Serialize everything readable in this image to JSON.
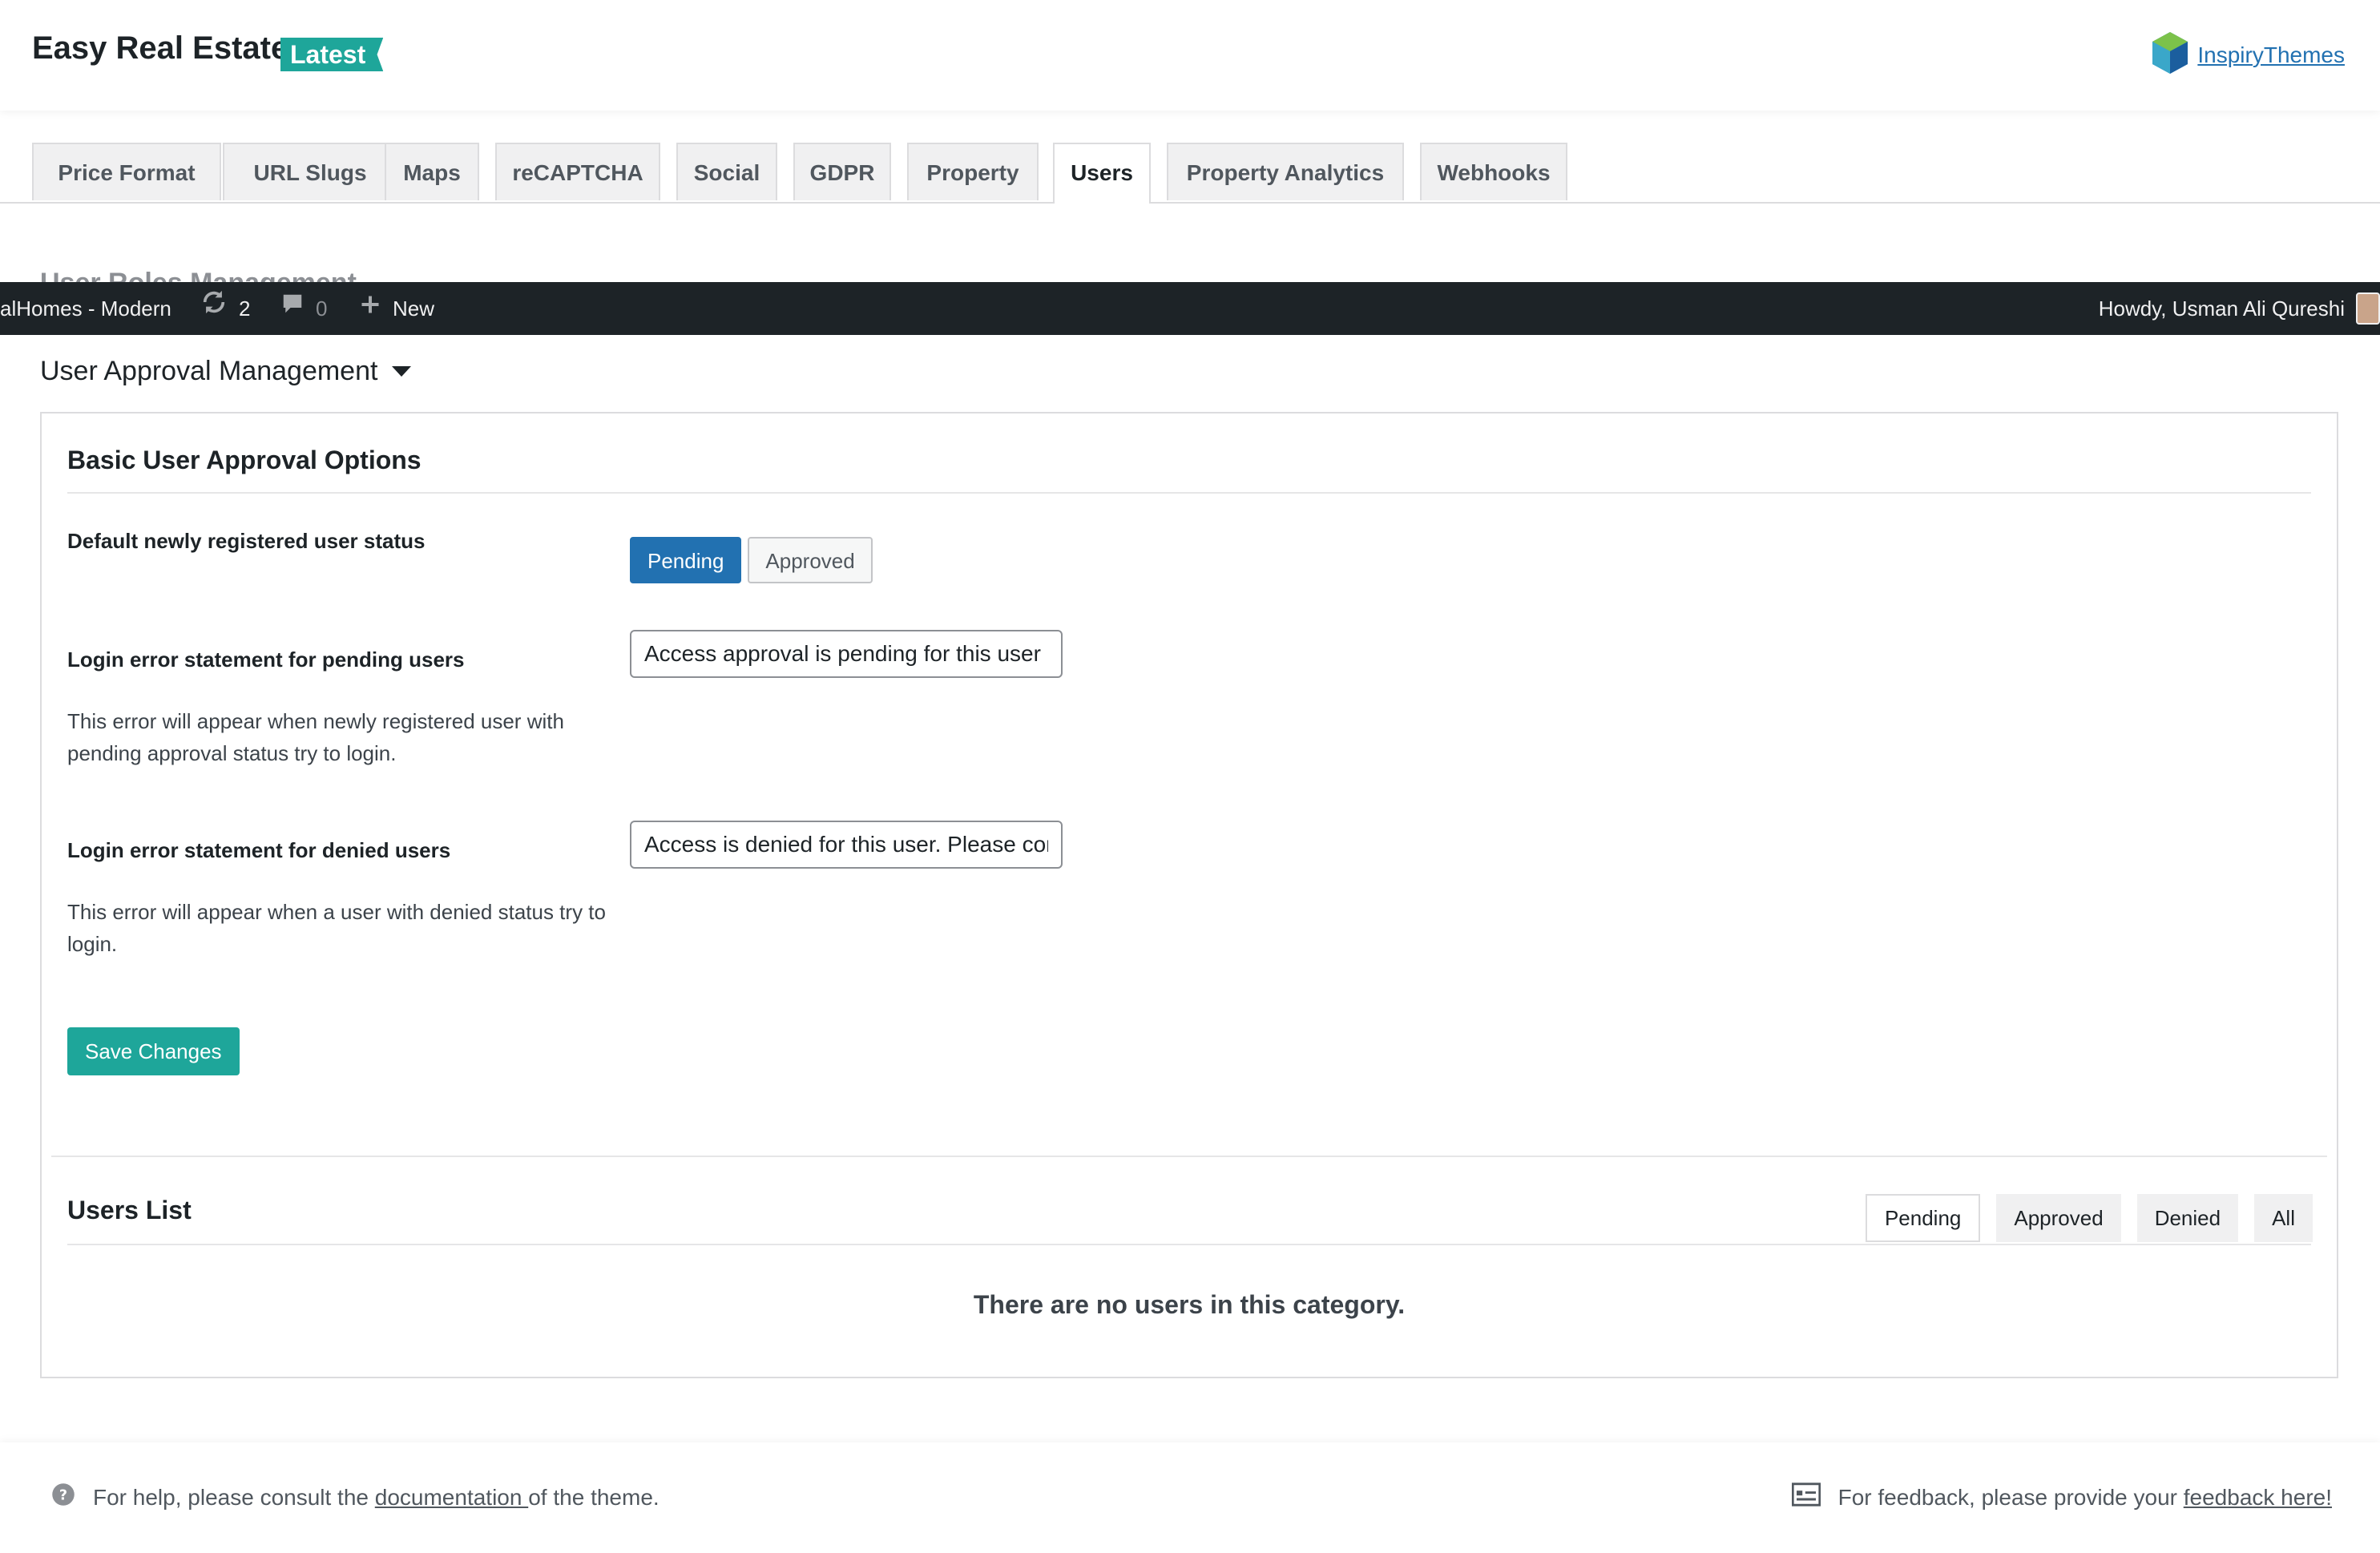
{
  "header": {
    "brand": "Easy Real Estate",
    "badge": "Latest",
    "vendor_link": "InspiryThemes"
  },
  "tabs": [
    {
      "label": "Price Format"
    },
    {
      "label": "URL Slugs"
    },
    {
      "label": "Maps"
    },
    {
      "label": "reCAPTCHA"
    },
    {
      "label": "Social"
    },
    {
      "label": "GDPR"
    },
    {
      "label": "Property"
    },
    {
      "label": "Users",
      "active": true
    },
    {
      "label": "Property Analytics"
    },
    {
      "label": "Webhooks"
    }
  ],
  "hidden_heading": "User Roles Management",
  "adminbar": {
    "site": "alHomes - Modern",
    "updates_count": "2",
    "comments_count": "0",
    "new_label": "New",
    "howdy": "Howdy, Usman Ali Qureshi"
  },
  "section": {
    "title": "User Approval Management",
    "basic_title": "Basic User Approval Options",
    "default_status_label": "Default newly registered user status",
    "status_options": [
      "Pending",
      "Approved"
    ],
    "selected_status": "Pending",
    "pending_label": "Login error statement for pending users",
    "pending_value": "Access approval is pending for this user",
    "pending_desc": "This error will appear when newly registered user with pending approval status try to login.",
    "denied_label": "Login error statement for denied users",
    "denied_value": "Access is denied for this user. Please contact",
    "denied_desc": "This error will appear when a user with denied status try to login.",
    "save_label": "Save Changes"
  },
  "users_list": {
    "title": "Users List",
    "filters": [
      "Pending",
      "Approved",
      "Denied",
      "All"
    ],
    "active_filter": "Pending",
    "empty_message": "There are no users in this category."
  },
  "footer": {
    "help_prefix": "For help, please consult the ",
    "help_link": "documentation ",
    "help_suffix": "of the theme.",
    "feedback_prefix": "For feedback, please provide your ",
    "feedback_link": "feedback here!"
  },
  "colors": {
    "accent": "#1ea69a",
    "primary": "#2271b1",
    "admin_bar": "#1d2327"
  }
}
